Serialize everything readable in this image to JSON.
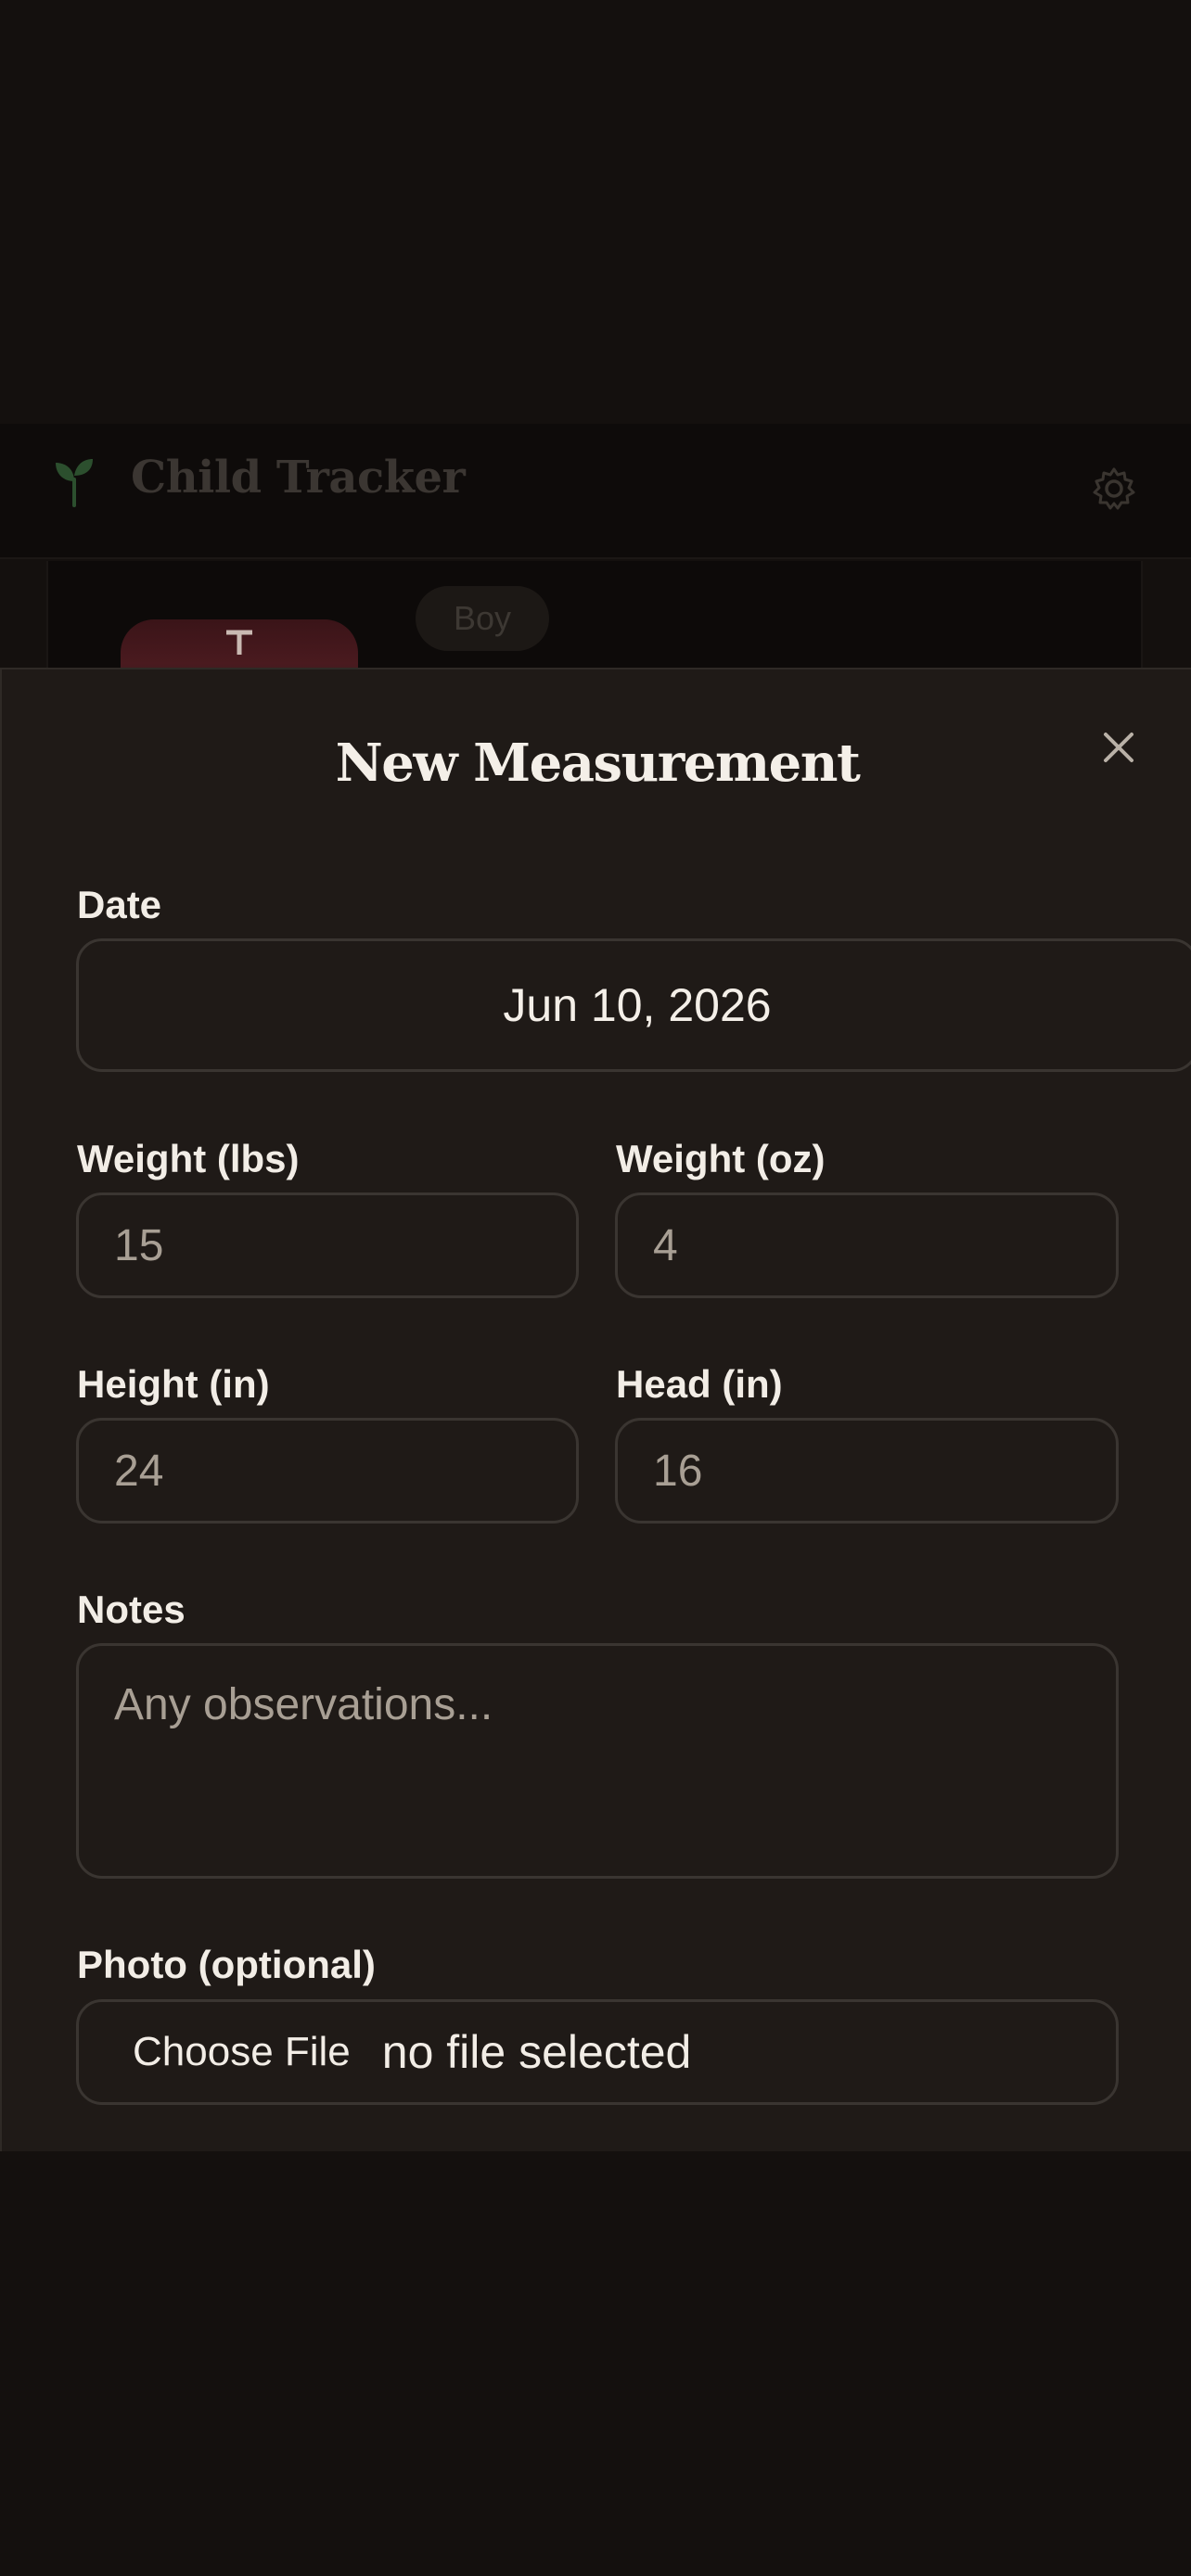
{
  "app": {
    "title": "Child Tracker",
    "badge": "Boy"
  },
  "modal": {
    "title": "New Measurement",
    "date": {
      "label": "Date",
      "value": "Jun 10, 2026"
    },
    "weight_lbs": {
      "label": "Weight (lbs)",
      "placeholder": "15"
    },
    "weight_oz": {
      "label": "Weight (oz)",
      "placeholder": "4"
    },
    "height_in": {
      "label": "Height (in)",
      "placeholder": "24"
    },
    "head_in": {
      "label": "Head (in)",
      "placeholder": "16"
    },
    "notes": {
      "label": "Notes",
      "placeholder": "Any observations..."
    },
    "photo": {
      "label": "Photo (optional)",
      "button": "Choose File",
      "status": "no file selected"
    }
  },
  "icons": {
    "logo": "sprout-icon",
    "settings": "gear-icon",
    "close": "close-icon"
  },
  "colors": {
    "background": "#14100e",
    "sheet": "#1f1a17",
    "accent_green": "#2f5a32"
  }
}
